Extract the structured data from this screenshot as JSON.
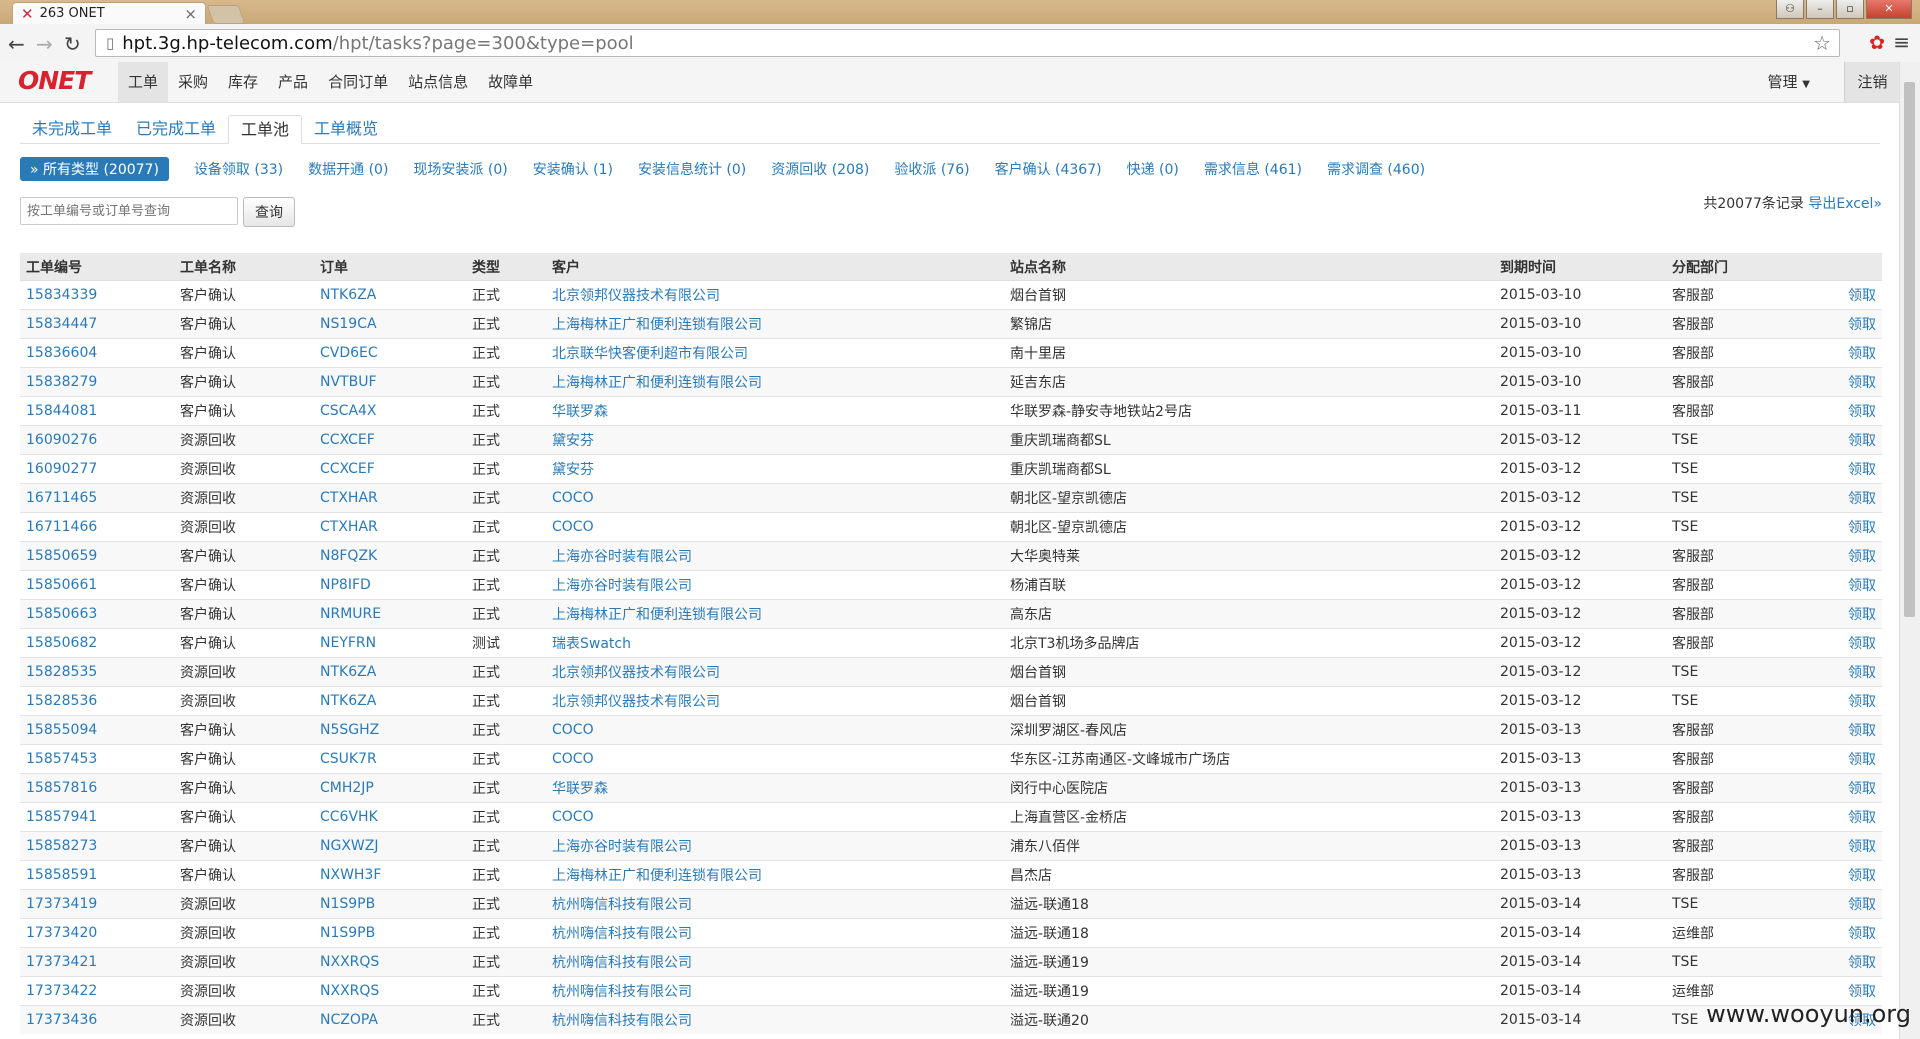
{
  "browser": {
    "tab_title": "263 ONET",
    "url_host": "hpt.3g.hp-telecom.com",
    "url_path": "/hpt/tasks?page=300&type=pool"
  },
  "app": {
    "logo": "ONET",
    "nav": [
      "工单",
      "采购",
      "库存",
      "产品",
      "合同订单",
      "站点信息",
      "故障单"
    ],
    "admin": "管理",
    "logout": "注销"
  },
  "tabs": [
    "未完成工单",
    "已完成工单",
    "工单池",
    "工单概览"
  ],
  "filters": [
    "» 所有类型 (20077)",
    "设备领取 (33)",
    "数据开通 (0)",
    "现场安装派 (0)",
    "安装确认 (1)",
    "安装信息统计 (0)",
    "资源回收 (208)",
    "验收派 (76)",
    "客户确认 (4367)",
    "快递 (0)",
    "需求信息 (461)",
    "需求调查 (460)"
  ],
  "search": {
    "placeholder": "按工单编号或订单号查询",
    "button": "查询"
  },
  "summary": {
    "records": "共20077条记录",
    "export": "导出Excel»"
  },
  "table": {
    "headers": [
      "工单编号",
      "工单名称",
      "订单",
      "类型",
      "客户",
      "站点名称",
      "到期时间",
      "分配部门",
      ""
    ],
    "action_label": "领取",
    "rows": [
      [
        "15834339",
        "客户确认",
        "NTK6ZA",
        "正式",
        "北京领邦仪器技术有限公司",
        "烟台首钢",
        "2015-03-10",
        "客服部"
      ],
      [
        "15834447",
        "客户确认",
        "NS19CA",
        "正式",
        "上海梅林正广和便利连锁有限公司",
        "繁锦店",
        "2015-03-10",
        "客服部"
      ],
      [
        "15836604",
        "客户确认",
        "CVD6EC",
        "正式",
        "北京联华快客便利超市有限公司",
        "南十里居",
        "2015-03-10",
        "客服部"
      ],
      [
        "15838279",
        "客户确认",
        "NVTBUF",
        "正式",
        "上海梅林正广和便利连锁有限公司",
        "延吉东店",
        "2015-03-10",
        "客服部"
      ],
      [
        "15844081",
        "客户确认",
        "CSCA4X",
        "正式",
        "华联罗森",
        "华联罗森-静安寺地铁站2号店",
        "2015-03-11",
        "客服部"
      ],
      [
        "16090276",
        "资源回收",
        "CCXCEF",
        "正式",
        "黛安芬",
        "重庆凯瑞商都SL",
        "2015-03-12",
        "TSE"
      ],
      [
        "16090277",
        "资源回收",
        "CCXCEF",
        "正式",
        "黛安芬",
        "重庆凯瑞商都SL",
        "2015-03-12",
        "TSE"
      ],
      [
        "16711465",
        "资源回收",
        "CTXHAR",
        "正式",
        "COCO",
        "朝北区-望京凯德店",
        "2015-03-12",
        "TSE"
      ],
      [
        "16711466",
        "资源回收",
        "CTXHAR",
        "正式",
        "COCO",
        "朝北区-望京凯德店",
        "2015-03-12",
        "TSE"
      ],
      [
        "15850659",
        "客户确认",
        "N8FQZK",
        "正式",
        "上海亦谷时装有限公司",
        "大华奥特莱",
        "2015-03-12",
        "客服部"
      ],
      [
        "15850661",
        "客户确认",
        "NP8IFD",
        "正式",
        "上海亦谷时装有限公司",
        "杨浦百联",
        "2015-03-12",
        "客服部"
      ],
      [
        "15850663",
        "客户确认",
        "NRMURE",
        "正式",
        "上海梅林正广和便利连锁有限公司",
        "高东店",
        "2015-03-12",
        "客服部"
      ],
      [
        "15850682",
        "客户确认",
        "NEYFRN",
        "测试",
        "瑞表Swatch",
        "北京T3机场多品牌店",
        "2015-03-12",
        "客服部"
      ],
      [
        "15828535",
        "资源回收",
        "NTK6ZA",
        "正式",
        "北京领邦仪器技术有限公司",
        "烟台首钢",
        "2015-03-12",
        "TSE"
      ],
      [
        "15828536",
        "资源回收",
        "NTK6ZA",
        "正式",
        "北京领邦仪器技术有限公司",
        "烟台首钢",
        "2015-03-12",
        "TSE"
      ],
      [
        "15855094",
        "客户确认",
        "N5SGHZ",
        "正式",
        "COCO",
        "深圳罗湖区-春风店",
        "2015-03-13",
        "客服部"
      ],
      [
        "15857453",
        "客户确认",
        "CSUK7R",
        "正式",
        "COCO",
        "华东区-江苏南通区-文峰城市广场店",
        "2015-03-13",
        "客服部"
      ],
      [
        "15857816",
        "客户确认",
        "CMH2JP",
        "正式",
        "华联罗森",
        "闵行中心医院店",
        "2015-03-13",
        "客服部"
      ],
      [
        "15857941",
        "客户确认",
        "CC6VHK",
        "正式",
        "COCO",
        "上海直营区-金桥店",
        "2015-03-13",
        "客服部"
      ],
      [
        "15858273",
        "客户确认",
        "NGXWZJ",
        "正式",
        "上海亦谷时装有限公司",
        "浦东八佰伴",
        "2015-03-13",
        "客服部"
      ],
      [
        "15858591",
        "客户确认",
        "NXWH3F",
        "正式",
        "上海梅林正广和便利连锁有限公司",
        "昌杰店",
        "2015-03-13",
        "客服部"
      ],
      [
        "17373419",
        "资源回收",
        "N1S9PB",
        "正式",
        "杭州嗨信科技有限公司",
        "溢远-联通18",
        "2015-03-14",
        "TSE"
      ],
      [
        "17373420",
        "资源回收",
        "N1S9PB",
        "正式",
        "杭州嗨信科技有限公司",
        "溢远-联通18",
        "2015-03-14",
        "运维部"
      ],
      [
        "17373421",
        "资源回收",
        "NXXRQS",
        "正式",
        "杭州嗨信科技有限公司",
        "溢远-联通19",
        "2015-03-14",
        "TSE"
      ],
      [
        "17373422",
        "资源回收",
        "NXXRQS",
        "正式",
        "杭州嗨信科技有限公司",
        "溢远-联通19",
        "2015-03-14",
        "运维部"
      ],
      [
        "17373436",
        "资源回收",
        "NCZOPA",
        "正式",
        "杭州嗨信科技有限公司",
        "溢远-联通20",
        "2015-03-14",
        "TSE"
      ]
    ]
  },
  "watermark": "www.wooyun.org"
}
